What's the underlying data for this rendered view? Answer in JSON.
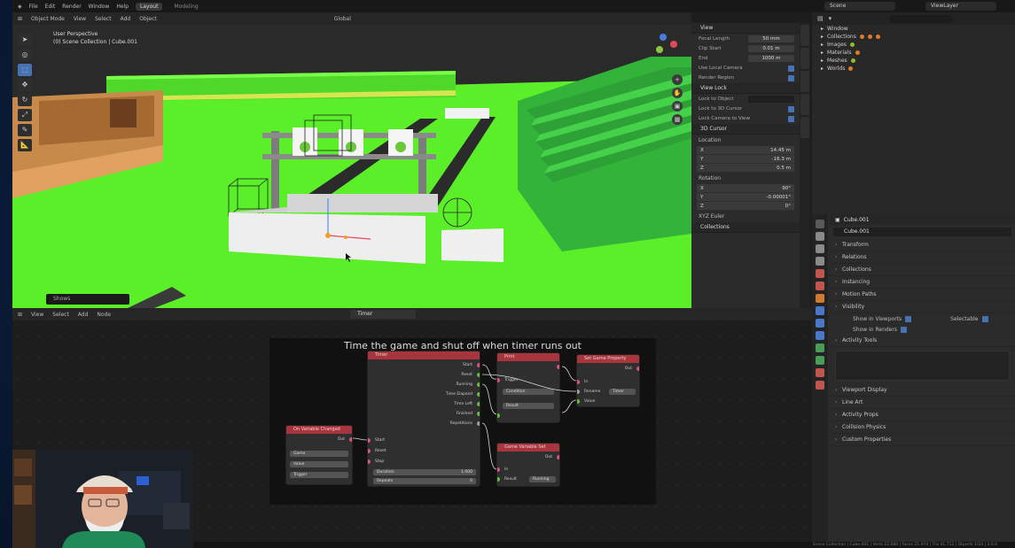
{
  "menubar": {
    "items": [
      "File",
      "Edit",
      "Render",
      "Window",
      "Help"
    ],
    "tabs": [
      "Layout",
      "Modeling"
    ],
    "scene": "Scene",
    "view_layer": "ViewLayer"
  },
  "viewport": {
    "header": [
      "Object Mode",
      "View",
      "Select",
      "Add",
      "Object",
      "Global"
    ],
    "info_line1": "User Perspective",
    "info_line2": "(0) Scene Collection | Cube.001",
    "status": "Shows"
  },
  "npanel": {
    "view_section": "View",
    "focal_length_label": "Focal Length",
    "focal_length_value": "50 mm",
    "clip_start_label": "Clip Start",
    "clip_start_value": "0.01 m",
    "clip_end_label": "End",
    "clip_end_value": "1000 m",
    "local_camera": "Use Local Camera",
    "render_region": "Render Region",
    "view_lock": "View Lock",
    "lock_to_object": "Lock to Object",
    "lock_3d_cursor": "Lock to 3D Cursor",
    "lock_camera_view": "Lock Camera to View",
    "cursor_section": "3D Cursor",
    "location_label": "Location",
    "loc": [
      [
        "X",
        "14.45 m"
      ],
      [
        "Y",
        "-16.3 m"
      ],
      [
        "Z",
        "0.5 m"
      ]
    ],
    "rotation_label": "Rotation",
    "rot": [
      [
        "X",
        "90°"
      ],
      [
        "Y",
        "-0.00001°"
      ],
      [
        "Z",
        "0°"
      ]
    ],
    "xyz_euler": "XYZ Euler",
    "collections_section": "Collections"
  },
  "outliner": {
    "rows": [
      "Window",
      "Collections",
      "Images",
      "Materials",
      "Meshes",
      "Worlds"
    ]
  },
  "properties": {
    "object_name": "Cube.001",
    "field_name": "Cube.001",
    "sections": [
      "Transform",
      "Relations",
      "Collections",
      "Instancing",
      "Motion Paths",
      "Visibility"
    ],
    "show_viewport": "Show in Viewports",
    "show_renders": "Show in Renders",
    "selectable": "Selectable",
    "activity_tools": "Activity Tools",
    "lower_sections": [
      "Viewport Display",
      "Line Art",
      "Activity Props",
      "Collision Physics",
      "Custom Properties"
    ]
  },
  "node_editor": {
    "header": [
      "View",
      "Select",
      "Add",
      "Node"
    ],
    "tree": "Timer",
    "frame_title": "Time the game and shut off when timer runs out",
    "node_timer_title": "Timer",
    "node_timer_outputs": [
      "Start",
      "Reset",
      "Running",
      "Time Elapsed",
      "Time Left",
      "Finished",
      "Repetitions"
    ],
    "node_timer_inputs": [
      "Start",
      "Reset",
      "Stop"
    ],
    "node_timer_fields": [
      [
        "Duration",
        "1.000"
      ],
      [
        "Repeats",
        "0"
      ]
    ],
    "node_left_title": "On Variable Changed",
    "node_left_out": "Out",
    "node_left_fields": [
      "Game",
      "Value",
      "Trigger"
    ],
    "node_mid_title": "Print",
    "node_mid_labels": [
      "Trigger",
      "Condition",
      "Result"
    ],
    "node_right_title": "Set Game Property",
    "node_right_labels": [
      "Out",
      "In",
      "Rename",
      "Value",
      "Timer"
    ],
    "node_bottom_title": "Game Variable Set",
    "node_bottom_labels": [
      "Out",
      "In",
      "Result",
      "Running"
    ]
  },
  "statusbar": "Scene Collection | Cube.001 | Verts 22,080 | Faces 21,974 | Tris 41,712 | Objects 1/24 | 3.6.0"
}
